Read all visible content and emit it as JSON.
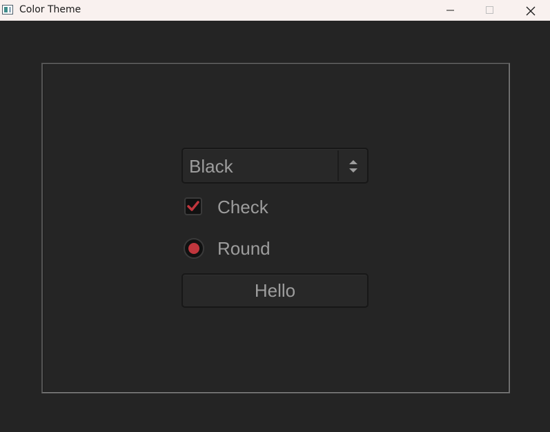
{
  "window": {
    "title": "Color Theme",
    "controls": {
      "minimize": "minimize-icon",
      "maximize": "maximize-icon",
      "close": "close-icon"
    }
  },
  "combo": {
    "selected": "Black",
    "icon": "updown-arrows-icon"
  },
  "checkbox": {
    "label": "Check",
    "checked": true,
    "icon": "checkmark-icon"
  },
  "radio": {
    "label": "Round",
    "selected": true
  },
  "button": {
    "label": "Hello"
  },
  "colors": {
    "background": "#242424",
    "titlebar": "#f9f1ef",
    "accent": "#c0363d",
    "text": "#9d9d9d"
  }
}
